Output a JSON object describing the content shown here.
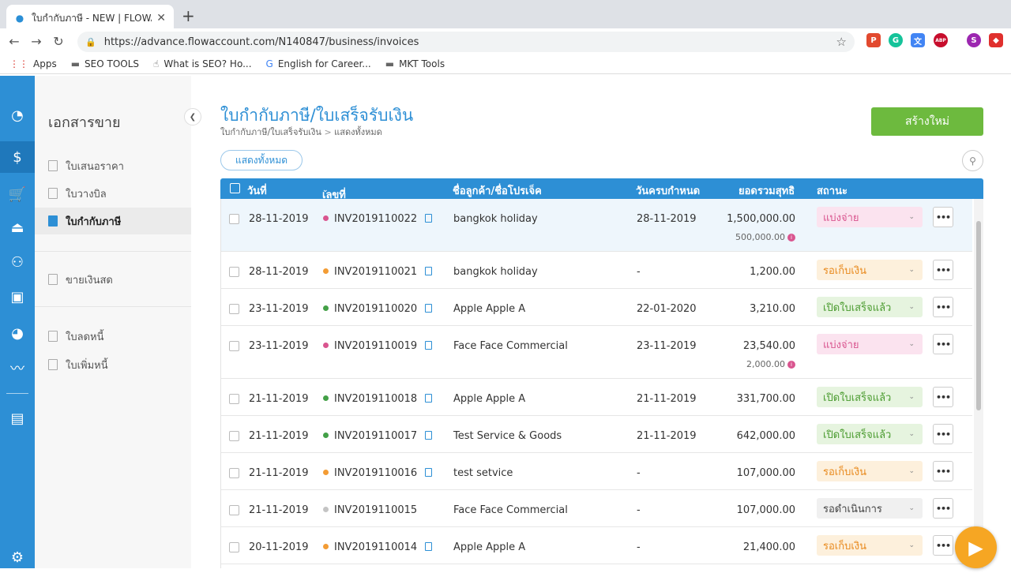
{
  "browser": {
    "tab_title": "ใบกำกับภาษี - NEW | FLOWACC",
    "url": "https://advance.flowaccount.com/N140847/business/invoices",
    "bookmarks": [
      "Apps",
      "SEO TOOLS",
      "What is SEO? Ho...",
      "English for Career...",
      "MKT Tools"
    ],
    "extensions": [
      {
        "name": "pdf-extension-icon",
        "glyph": "P",
        "color": "#e2492f"
      },
      {
        "name": "grammarly-icon",
        "glyph": "G",
        "color": "#15c39a"
      },
      {
        "name": "translate-icon",
        "glyph": "文",
        "color": "#4285f4"
      },
      {
        "name": "adblock-icon",
        "glyph": "ABP",
        "color": "#c70d2c"
      },
      {
        "name": "profile-avatar",
        "glyph": "S",
        "color": "#9c27b0"
      },
      {
        "name": "extension-icon",
        "glyph": "◆",
        "color": "#e0302d"
      }
    ]
  },
  "subnav": {
    "title": "เอกสารขาย",
    "items": [
      {
        "label": "ใบเสนอราคา"
      },
      {
        "label": "ใบวางบิล"
      },
      {
        "label": "ใบกำกับภาษี"
      },
      {
        "label": "ขายเงินสด"
      },
      {
        "label": "ใบลดหนี้"
      },
      {
        "label": "ใบเพิ่มหนี้"
      }
    ]
  },
  "page": {
    "title": "ใบกำกับภาษี/ใบเสร็จรับเงิน",
    "breadcrumb_1": "ใบกำกับภาษี/ใบเสร็จรับเงิน",
    "breadcrumb_sep": ">",
    "breadcrumb_2": "แสดงทั้งหมด",
    "new_button": "สร้างใหม่",
    "filter_label": "แสดงทั้งหมด"
  },
  "table": {
    "headers": {
      "date": "วันที่",
      "doc_no": "เลขที่เอกสาร",
      "customer": "ชื่อลูกค้า/ชื่อโปรเจ็ค",
      "due": "วันครบกำหนด",
      "total": "ยอดรวมสุทธิ",
      "status": "สถานะ"
    },
    "rows": [
      {
        "date": "28-11-2019",
        "doc_no": "INV2019110022",
        "customer": "bangkok holiday",
        "due": "28-11-2019",
        "total": "1,500,000.00",
        "sub_total": "500,000.00",
        "status": "แบ่งจ่าย",
        "dot": "#d9558f",
        "status_bg": "#fbe3ef",
        "status_fg": "#d9558f",
        "has_doc": true
      },
      {
        "date": "28-11-2019",
        "doc_no": "INV2019110021",
        "customer": "bangkok holiday",
        "due": "-",
        "total": "1,200.00",
        "status": "รอเก็บเงิน",
        "dot": "#f39c34",
        "status_bg": "#fdf0dc",
        "status_fg": "#e8891c",
        "has_doc": true
      },
      {
        "date": "23-11-2019",
        "doc_no": "INV2019110020",
        "customer": "Apple Apple A",
        "due": "22-01-2020",
        "total": "3,210.00",
        "status": "เปิดใบเสร็จแล้ว",
        "dot": "#43a047",
        "status_bg": "#e6f4df",
        "status_fg": "#4a9b2f",
        "has_doc": true
      },
      {
        "date": "23-11-2019",
        "doc_no": "INV2019110019",
        "customer": "Face Face Commercial",
        "due": "23-11-2019",
        "total": "23,540.00",
        "sub_total": "2,000.00",
        "status": "แบ่งจ่าย",
        "dot": "#d9558f",
        "status_bg": "#fbe3ef",
        "status_fg": "#d9558f",
        "has_doc": true
      },
      {
        "date": "21-11-2019",
        "doc_no": "INV2019110018",
        "customer": "Apple Apple A",
        "due": "21-11-2019",
        "total": "331,700.00",
        "status": "เปิดใบเสร็จแล้ว",
        "dot": "#43a047",
        "status_bg": "#e6f4df",
        "status_fg": "#4a9b2f",
        "has_doc": true
      },
      {
        "date": "21-11-2019",
        "doc_no": "INV2019110017",
        "customer": "Test Service & Goods",
        "due": "21-11-2019",
        "total": "642,000.00",
        "status": "เปิดใบเสร็จแล้ว",
        "dot": "#43a047",
        "status_bg": "#e6f4df",
        "status_fg": "#4a9b2f",
        "has_doc": true
      },
      {
        "date": "21-11-2019",
        "doc_no": "INV2019110016",
        "customer": "test setvice",
        "due": "-",
        "total": "107,000.00",
        "status": "รอเก็บเงิน",
        "dot": "#f39c34",
        "status_bg": "#fdf0dc",
        "status_fg": "#e8891c",
        "has_doc": true
      },
      {
        "date": "21-11-2019",
        "doc_no": "INV2019110015",
        "customer": "Face Face Commercial",
        "due": "-",
        "total": "107,000.00",
        "status": "รอดำเนินการ",
        "dot": "#c4c4c4",
        "status_bg": "#f0f0f0",
        "status_fg": "#444444",
        "has_doc": false
      },
      {
        "date": "20-11-2019",
        "doc_no": "INV2019110014",
        "customer": "Apple Apple A",
        "due": "-",
        "total": "21,400.00",
        "status": "รอเก็บเงิน",
        "dot": "#f39c34",
        "status_bg": "#fdf0dc",
        "status_fg": "#e8891c",
        "has_doc": true
      }
    ]
  }
}
